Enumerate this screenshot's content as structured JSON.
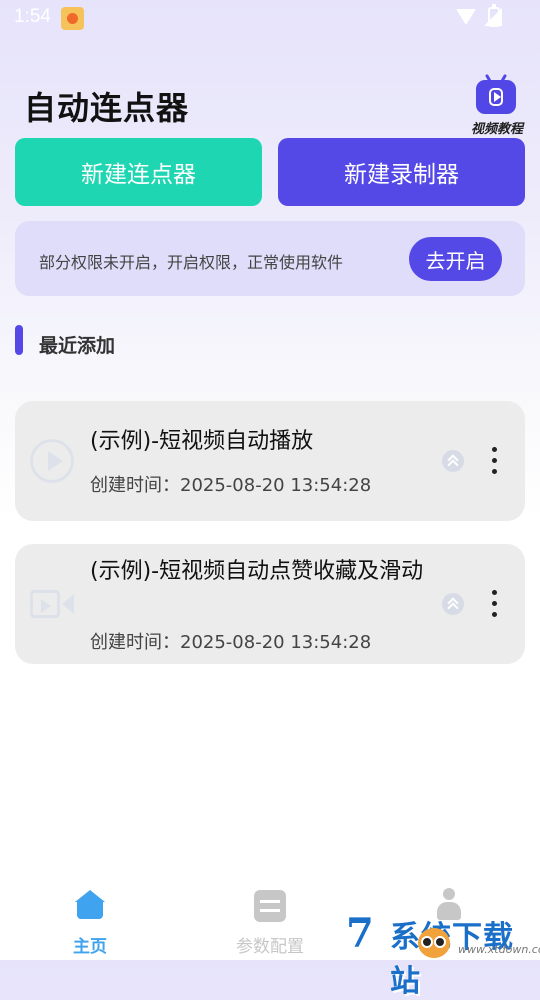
{
  "status_bar": {
    "time": "1:54"
  },
  "header": {
    "title": "自动连点器",
    "tutorial_label": "视频教程"
  },
  "actions": {
    "new_clicker": "新建连点器",
    "new_recorder": "新建录制器"
  },
  "permission": {
    "message": "部分权限未开启，开启权限，正常使用软件",
    "button": "去开启"
  },
  "section": {
    "title": "最近添加"
  },
  "items": [
    {
      "title": "(示例)-短视频自动播放",
      "created": "创建时间：2025-08-20 13:54:28",
      "icon": "play-circle-icon"
    },
    {
      "title": "(示例)-短视频自动点赞收藏及滑动",
      "created": "创建时间：2025-08-20 13:54:28",
      "icon": "video-camera-icon"
    }
  ],
  "nav": {
    "items": [
      {
        "label": "主页",
        "icon": "home-icon",
        "active": true
      },
      {
        "label": "参数配置",
        "icon": "settings-sliders-icon",
        "active": false
      },
      {
        "label": "",
        "icon": "person-icon",
        "active": false
      }
    ]
  },
  "watermark": {
    "text": "系统下载站",
    "logo": "7",
    "url": "www.xtdown.com"
  },
  "colors": {
    "accent": "#5449e6",
    "teal": "#1ed7b2",
    "nav_active": "#3fa3ef",
    "nav_inactive": "#c7c7c7"
  }
}
